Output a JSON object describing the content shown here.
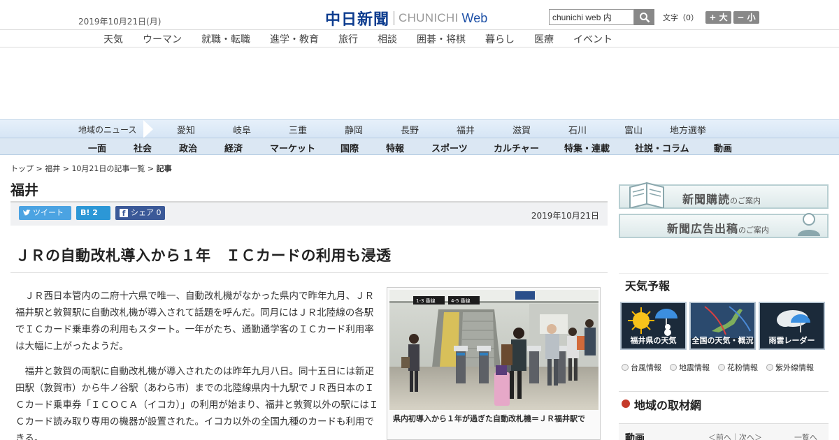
{
  "header": {
    "date": "2019年10月21日(月)",
    "logo_kanji": "中日新聞",
    "logo_en": "CHUNICHI",
    "logo_web": "Web",
    "search_value": "chunichi web 内",
    "search_icon": "magnifier-icon",
    "fontsize_label": "文字（0）",
    "font_larger": "+ 大",
    "font_smaller": "− 小"
  },
  "genre_nav": [
    "天気",
    "ウーマン",
    "就職・転職",
    "進学・教育",
    "旅行",
    "相談",
    "囲碁・将棋",
    "暮らし",
    "医療",
    "イベント"
  ],
  "region_nav": {
    "label": "地域のニュース",
    "items": [
      "愛知",
      "岐阜",
      "三重",
      "静岡",
      "長野",
      "福井",
      "滋賀",
      "石川",
      "富山",
      "地方選挙"
    ]
  },
  "section_nav": [
    "一面",
    "社会",
    "政治",
    "経済",
    "マーケット",
    "国際",
    "特報",
    "スポーツ",
    "カルチャー",
    "特集・連載",
    "社説・コラム",
    "動画"
  ],
  "breadcrumb": {
    "top": "トップ",
    "pref": "福井",
    "list": "10月21日の記事一覧",
    "current": "記事",
    "sep": " > "
  },
  "pref_title": "福井",
  "share": {
    "tweet": "ツイート",
    "hatena": "B! 2",
    "facebook": "シェア 0",
    "date": "2019年10月21日"
  },
  "article": {
    "headline": "ＪＲの自動改札導入から１年　ＩＣカードの利用も浸透",
    "paragraphs": [
      "ＪＲ西日本管内の二府十六県で唯一、自動改札機がなかった県内で昨年九月、ＪＲ福井駅と敦賀駅に自動改札機が導入されて話題を呼んだ。同月にはＪＲ北陸線の各駅でＩＣカード乗車券の利用もスタート。一年がたち、通勤通学客のＩＣカード利用率は大幅に上がったようだ。",
      "福井と敦賀の両駅に自動改札機が導入されたのは昨年九月八日。同十五日には新疋田駅（敦賀市）から牛ノ谷駅（あわら市）までの北陸線県内十九駅でＪＲ西日本のＩＣカード乗車券「ＩＣＯＣＡ（イコカ）」の利用が始まり、福井と敦賀以外の駅にはＩＣカード読み取り専用の機器が設置された。イコカ以外の全国九種のカードも利用できる。"
    ],
    "photo_caption": "県内初導入から１年が過ぎた自動改札機＝ＪＲ福井駅で",
    "photo_signs": [
      "1-3 番線",
      "4-5 番線"
    ]
  },
  "sidebar": {
    "banner1": {
      "main": "新聞購読",
      "sub": "のご案内"
    },
    "banner2": {
      "main": "新聞広告出稿",
      "sub": "のご案内"
    },
    "weather_title": "天気予報",
    "tiles": [
      "福井県の天気",
      "全国の天気・概況",
      "雨雲レーダー"
    ],
    "links": [
      "台風情報",
      "地震情報",
      "花粉情報",
      "紫外線情報"
    ],
    "bureau_title": "地域の取材網",
    "video_title": "動画",
    "video_nav": "＜前へ｜次へ＞",
    "video_all": "一覧へ"
  },
  "colors": {
    "logo_blue": "#0d3c8f",
    "twitter": "#4ba3e2",
    "hatena": "#2c97d6",
    "facebook": "#3b5998",
    "nav_bg": "#dbe7f3"
  }
}
